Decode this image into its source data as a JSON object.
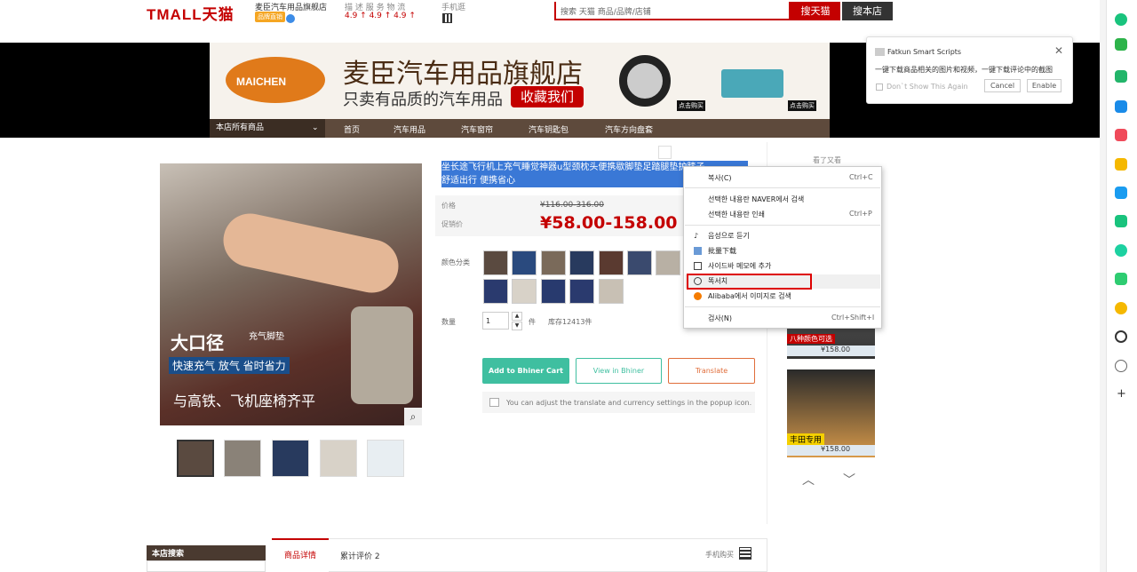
{
  "header": {
    "logo": "TMALL天猫",
    "shop_name": "麦臣汽车用品旗舰店",
    "shop_badge": "品牌直销",
    "ratings_label": "描 述  服 务  物 流",
    "ratings_values": "4.9 ↑ 4.9 ↑ 4.9 ↑",
    "mobile_label": "手机逛",
    "search_placeholder": "搜索 天猫 商品/品牌/店铺",
    "search_tmall": "搜天猫",
    "search_shop": "搜本店"
  },
  "banner": {
    "logo_text": "MAICHEN",
    "title": "麦臣汽车用品旗舰店",
    "subtitle": "只卖有品质的汽车用品",
    "favorite": "收藏我们",
    "buy_tag1": "点击购买",
    "buy_tag2": "点击购买",
    "nav_all": "本店所有商品",
    "nav_items": [
      "首页",
      "汽车用品",
      "汽车窗帘",
      "汽车钥匙包",
      "汽车方向盘套"
    ]
  },
  "gallery": {
    "overlay_big": "大口径",
    "overlay_big_sub": "充气脚垫",
    "overlay_mid": "快速充气 放气  省时省力",
    "overlay_bottom": "与高铁、飞机座椅齐平"
  },
  "product": {
    "title": "坐长途飞行机上充气睡觉神器u型颈枕头便携歇脚垫足踏腿垫护膝子",
    "subtitle": "舒适出行 便携省心",
    "price_label": "价格",
    "price_original": "¥116.00-316.00",
    "promo_label": "促销价",
    "promo_price": "¥58.00-158.00",
    "color_label": "颜色分类",
    "qty_label": "数量",
    "qty_value": "1",
    "qty_unit": "件",
    "stock": "库存12413件",
    "btn_add": "Add to Bhiner Cart",
    "btn_view": "View in Bhiner",
    "btn_translate": "Translate",
    "tip": "You can adjust the translate and currency settings in the popup icon."
  },
  "recommend": {
    "label": "看了又看",
    "items": [
      {
        "caption": "八种颜色可选",
        "price": "¥158.00"
      },
      {
        "caption": "丰田专用",
        "price": "¥158.00"
      }
    ]
  },
  "bottom": {
    "shop_search": "本店搜索",
    "tab_detail": "商品详情",
    "tab_reviews": "累计评价 2",
    "mobile_buy": "手机购买"
  },
  "popup": {
    "title": "Fatkun Smart Scripts",
    "desc": "一键下载商品相关的图片和视频，一键下载评论中的截图",
    "dont_show": "Don`t Show This Again",
    "cancel": "Cancel",
    "enable": "Enable"
  },
  "context_menu": {
    "items": [
      {
        "label": "복사(C)",
        "shortcut": "Ctrl+C"
      },
      {
        "label": "선택한 내용란 NAVER에서 검색",
        "shortcut": ""
      },
      {
        "label": "선택한 내용란 인쇄",
        "shortcut": "Ctrl+P"
      },
      {
        "label": "음성으로 듣기",
        "shortcut": ""
      },
      {
        "label": "批量下载",
        "shortcut": ""
      },
      {
        "label": "사이드바 메모에 추가",
        "shortcut": ""
      },
      {
        "label": "똑서치",
        "shortcut": ""
      },
      {
        "label": "Alibaba에서 이미지로 검색",
        "shortcut": ""
      },
      {
        "label": "검사(N)",
        "shortcut": "Ctrl+Shift+I"
      }
    ]
  },
  "colors": {
    "tmall_red": "#c40000",
    "bhiner_green": "#3fbfa0",
    "translate_orange": "#e06d3a",
    "selection_blue": "#3a78d6"
  }
}
